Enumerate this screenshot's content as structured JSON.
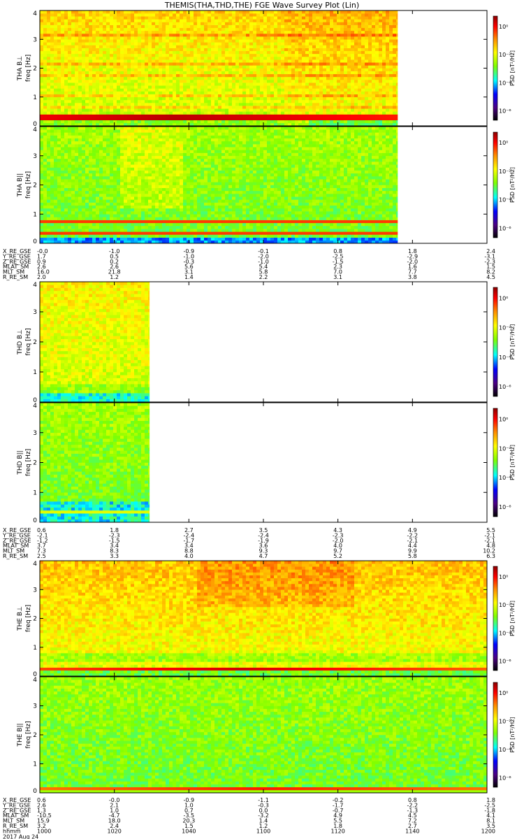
{
  "chart_data": {
    "type": "heatmap",
    "title": "THEMIS(THA,THD,THE) FGE Wave Survey Plot (Lin)",
    "x_axis": {
      "date_label": "2017 Aug 24",
      "unit_label": "hhmm",
      "ticks": [
        "1000",
        "1020",
        "1040",
        "1100",
        "1120",
        "1140",
        "1200"
      ],
      "range": [
        "1000",
        "1200"
      ]
    },
    "colorbar": {
      "label": "PSD [nT²/Hz]",
      "ticks": [
        "10⁰",
        "10⁻²",
        "10⁻⁴",
        "10⁻⁶"
      ],
      "colormap": [
        "#000000",
        "#4b0082",
        "#0000ff",
        "#00ffff",
        "#7fff00",
        "#ffff00",
        "#ff8c00",
        "#ff0000",
        "#8b0000"
      ]
    },
    "panels": [
      {
        "name": "THA B⊥",
        "probe": "THA",
        "component": "B⊥",
        "ylabel": "freq [Hz]",
        "yticks": [
          "0",
          "1",
          "2",
          "3",
          "4"
        ],
        "ylim": [
          0,
          4
        ],
        "data_end_fraction": 0.8,
        "cb_ticks": [
          "10⁰",
          "10⁻²",
          "10⁻⁴",
          "10⁻⁶"
        ]
      },
      {
        "name": "THA B||",
        "probe": "THA",
        "component": "B||",
        "ylabel": "freq [Hz]",
        "yticks": [
          "0",
          "1",
          "2",
          "3",
          "4"
        ],
        "ylim": [
          0,
          4
        ],
        "data_end_fraction": 0.8,
        "cb_ticks": [
          "10⁰",
          "10⁻²",
          "10⁻⁴",
          "10⁻⁶"
        ]
      },
      {
        "name": "THD B⊥",
        "probe": "THD",
        "component": "B⊥",
        "ylabel": "freq [Hz]",
        "yticks": [
          "0",
          "1",
          "2",
          "3",
          "4"
        ],
        "ylim": [
          0,
          4
        ],
        "data_end_fraction": 0.245,
        "cb_ticks": [
          "10⁰",
          "10⁻²",
          "10⁻⁴",
          "10⁻⁶"
        ]
      },
      {
        "name": "THD B||",
        "probe": "THD",
        "component": "B||",
        "ylabel": "freq [Hz]",
        "yticks": [
          "0",
          "1",
          "2",
          "3",
          "4"
        ],
        "ylim": [
          0,
          4
        ],
        "data_end_fraction": 0.245,
        "cb_ticks": [
          "10⁰",
          "10⁻²",
          "10⁻⁴",
          "10⁻⁶"
        ]
      },
      {
        "name": "THE B⊥",
        "probe": "THE",
        "component": "B⊥",
        "ylabel": "freq [Hz]",
        "yticks": [
          "0",
          "1",
          "2",
          "3",
          "4"
        ],
        "ylim": [
          0,
          4
        ],
        "data_end_fraction": 1.0,
        "cb_ticks": [
          "10⁰",
          "10⁻²",
          "10⁻⁴",
          "10⁻⁶"
        ]
      },
      {
        "name": "THE B||",
        "probe": "THE",
        "component": "B||",
        "ylabel": "freq [Hz]",
        "yticks": [
          "0",
          "1",
          "2",
          "3",
          "4"
        ],
        "ylim": [
          0,
          4
        ],
        "data_end_fraction": 1.0,
        "cb_ticks": [
          "10⁰",
          "10⁻²",
          "10⁻⁴",
          "10⁻⁶"
        ]
      }
    ],
    "orbit_tables": [
      {
        "probe": "THA",
        "rows": [
          {
            "label": "X_RE_GSE",
            "values": [
              "-0.0",
              "-1.0",
              "-0.9",
              "-0.1",
              "0.8",
              "1.8",
              "2.4"
            ]
          },
          {
            "label": "Y_RE_GSE",
            "values": [
              "1.7",
              "0.5",
              "-1.0",
              "-2.0",
              "-2.5",
              "-2.9",
              "-3.1"
            ]
          },
          {
            "label": "Z_RE_GSE",
            "values": [
              "0.9",
              "0.2",
              "-0.3",
              "-1.0",
              "-1.5",
              "-2.0",
              "-2.3"
            ]
          },
          {
            "label": "MLAT_SM",
            "values": [
              "2.6",
              "2.6",
              "5.6",
              "5.4",
              "2.3",
              "1.6",
              "1.5"
            ]
          },
          {
            "label": "MLT_SM",
            "values": [
              "16.0",
              "21.8",
              "3.1",
              "5.8",
              "7.0",
              "7.7",
              "8.2"
            ]
          },
          {
            "label": "R_RE_SM",
            "values": [
              "2.0",
              "1.2",
              "1.4",
              "2.2",
              "3.1",
              "3.8",
              "4.5"
            ]
          }
        ]
      },
      {
        "probe": "THD",
        "rows": [
          {
            "label": "X_RE_GSE",
            "values": [
              "0.6",
              "1.8",
              "2.7",
              "3.5",
              "4.3",
              "4.9",
              "5.5"
            ]
          },
          {
            "label": "Y_RE_GSE",
            "values": [
              "-2.1",
              "-2.3",
              "-2.4",
              "-2.4",
              "-2.3",
              "-2.2",
              "-2.1"
            ]
          },
          {
            "label": "Z_RE_GSE",
            "values": [
              "-1.2",
              "-1.5",
              "-1.7",
              "-1.9",
              "-2.0",
              "-2.1",
              "-2.1"
            ]
          },
          {
            "label": "MLAT_SM",
            "values": [
              "3.7",
              "3.4",
              "3.4",
              "3.6",
              "4.0",
              "4.4",
              "4.8"
            ]
          },
          {
            "label": "MLT_SM",
            "values": [
              "7.3",
              "8.3",
              "8.8",
              "9.3",
              "9.7",
              "9.9",
              "10.2"
            ]
          },
          {
            "label": "R_RE_SM",
            "values": [
              "2.5",
              "3.3",
              "4.0",
              "4.7",
              "5.2",
              "5.8",
              "6.3"
            ]
          }
        ]
      },
      {
        "probe": "THE",
        "rows": [
          {
            "label": "X_RE_GSE",
            "values": [
              "0.6",
              "-0.0",
              "-0.9",
              "-1.1",
              "-0.2",
              "0.8",
              "1.8"
            ]
          },
          {
            "label": "Y_RE_GSE",
            "values": [
              "2.6",
              "2.1",
              "1.0",
              "-0.3",
              "-1.7",
              "-2.2",
              "-2.5"
            ]
          },
          {
            "label": "Z_RE_GSE",
            "values": [
              "1.3",
              "1.0",
              "0.7",
              "0.0",
              "-0.7",
              "-1.3",
              "-1.8"
            ]
          },
          {
            "label": "MLAT_SM",
            "values": [
              "-10.5",
              "-4.7",
              "-3.5",
              "-3.2",
              "4.9",
              "4.5",
              "4.1"
            ]
          },
          {
            "label": "MLT_SM",
            "values": [
              "15.9",
              "18.0",
              "20.3",
              "1.4",
              "5.5",
              "7.2",
              "8.1"
            ]
          },
          {
            "label": "R_RE_SM",
            "values": [
              "3.2",
              "2.4",
              "1.5",
              "1.2",
              "1.8",
              "2.7",
              "3.5"
            ]
          }
        ]
      }
    ]
  }
}
